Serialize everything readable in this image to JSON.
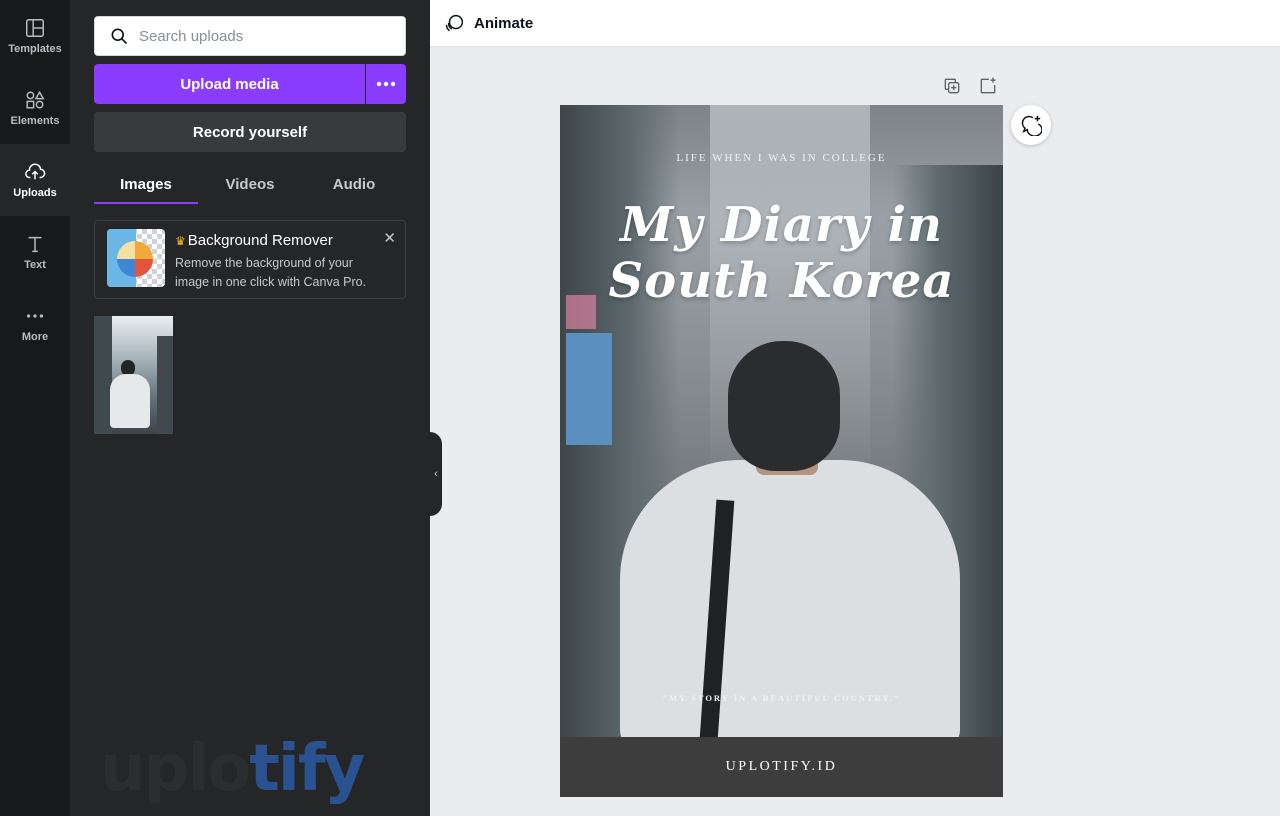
{
  "sidebar": {
    "items": [
      {
        "label": "Templates",
        "icon": "templates-icon"
      },
      {
        "label": "Elements",
        "icon": "elements-icon"
      },
      {
        "label": "Uploads",
        "icon": "upload-cloud-icon"
      },
      {
        "label": "Text",
        "icon": "text-icon"
      },
      {
        "label": "More",
        "icon": "more-icon"
      }
    ],
    "active": "Uploads"
  },
  "panel": {
    "search_placeholder": "Search uploads",
    "upload_label": "Upload media",
    "record_label": "Record yourself",
    "tabs": [
      {
        "label": "Images",
        "active": true
      },
      {
        "label": "Videos",
        "active": false
      },
      {
        "label": "Audio",
        "active": false
      }
    ],
    "promo": {
      "title": "Background Remover",
      "description": "Remove the background of your image in one click with Canva Pro."
    },
    "watermark": {
      "part1": "uplo",
      "part2": "tify"
    }
  },
  "topbar": {
    "animate_label": "Animate"
  },
  "poster": {
    "kicker": "LIFE WHEN I WAS IN COLLEGE",
    "title_line1": "My Diary in",
    "title_line2": "South Korea",
    "quote": "\"MY STORY IN A BEAUTIFUL COUNTRY.\"",
    "brand": "UPLOTIFY.ID"
  },
  "colors": {
    "accent": "#8b3dff",
    "panel_bg": "#252627",
    "rail_bg": "#18191b",
    "canvas_bg": "#ebecf0"
  }
}
